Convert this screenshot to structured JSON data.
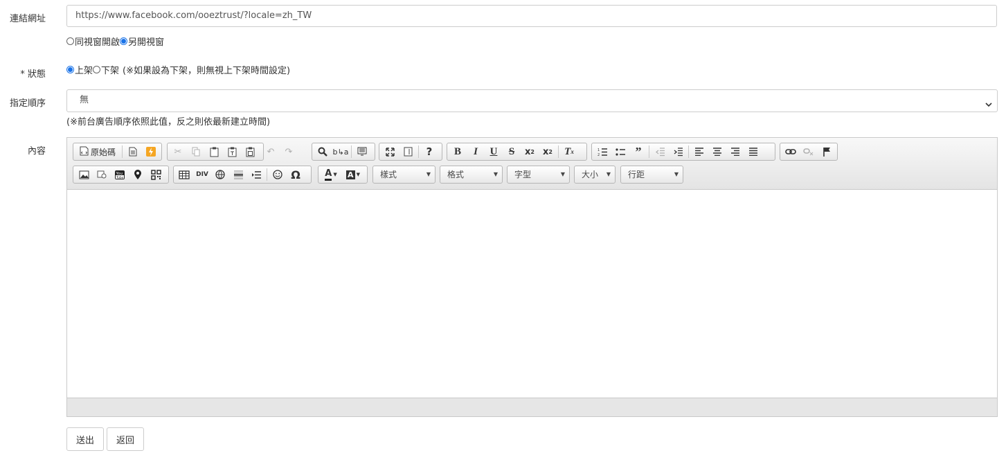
{
  "link": {
    "label": "連結網址",
    "url": "https://www.facebook.com/ooeztrust/?locale=zh_TW",
    "window_options": [
      {
        "label": "同視窗開啟",
        "checked": false
      },
      {
        "label": "另開視窗",
        "checked": true
      }
    ]
  },
  "status": {
    "label": "* 狀態",
    "options": [
      {
        "label": "上架",
        "checked": true
      },
      {
        "label": "下架",
        "checked": false
      }
    ],
    "note": "(※如果設為下架，則無視上下架時間設定)"
  },
  "order": {
    "label": "指定順序",
    "selected": "無",
    "note": "(※前台廣告順序依照此值，反之則依最新建立時間)"
  },
  "content": {
    "label": "內容",
    "source_label": "原始碼",
    "combos": {
      "style": "樣式",
      "format": "格式",
      "font": "字型",
      "size": "大小",
      "line_height": "行距"
    }
  },
  "actions": {
    "submit": "送出",
    "back": "返回"
  },
  "colors": {
    "accent": "#1a73e8",
    "flash_icon": "#f5a623"
  }
}
